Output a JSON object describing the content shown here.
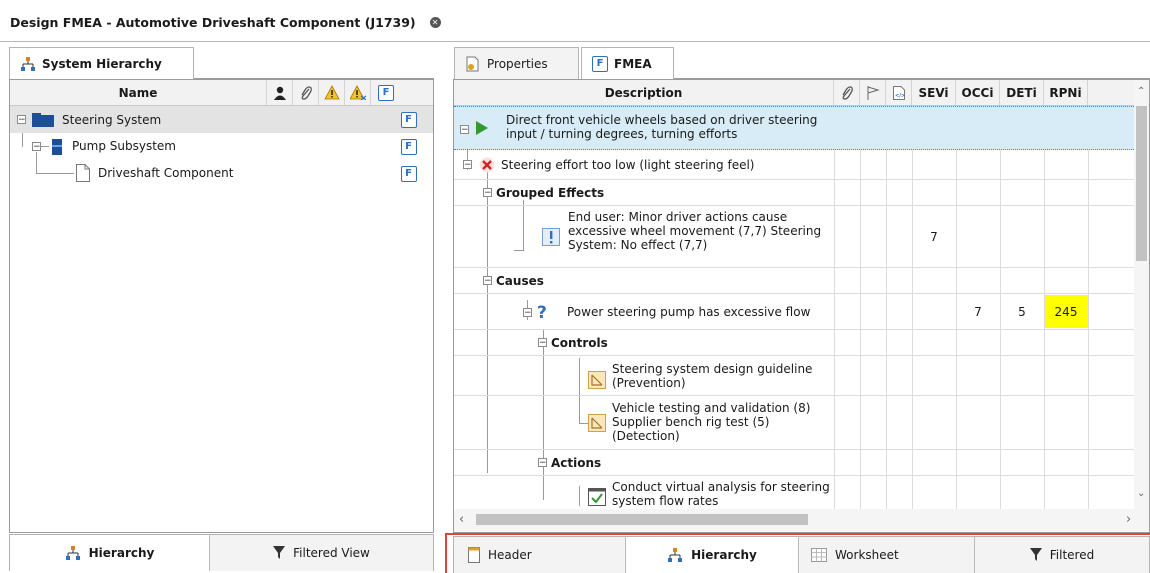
{
  "document_tab": {
    "title": "Design FMEA - Automotive Driveshaft Component (J1739)"
  },
  "left_panel": {
    "tab_label": "System Hierarchy",
    "columns": {
      "name": "Name"
    },
    "tree": [
      {
        "label": "Steering System",
        "expander": "−"
      },
      {
        "label": "Pump Subsystem",
        "expander": "−"
      },
      {
        "label": "Driveshaft Component"
      }
    ],
    "bottom_tabs": [
      {
        "label": "Hierarchy"
      },
      {
        "label": "Filtered View"
      }
    ]
  },
  "right_panel": {
    "tabs": [
      {
        "label": "Properties"
      },
      {
        "label": "FMEA"
      }
    ],
    "columns": {
      "description": "Description",
      "sev": "SEVi",
      "occ": "OCCi",
      "det": "DETi",
      "rpn": "RPNi"
    },
    "function_text": "Direct front vehicle wheels based on driver steering input / turning degrees, turning efforts",
    "failure_text": "Steering effort too low (light steering feel)",
    "grouped_effects_label": "Grouped Effects",
    "effect_text": "End user: Minor driver actions cause excessive wheel movement (7,7) Steering System: No effect (7,7)",
    "effect_sev": "7",
    "causes_label": "Causes",
    "cause_text": "Power steering pump has excessive flow",
    "cause_occ": "7",
    "cause_det": "5",
    "cause_rpn": "245",
    "controls_label": "Controls",
    "control_1": "Steering system design guideline (Prevention)",
    "control_2": "Vehicle testing and validation (8) Supplier bench rig test (5) (Detection)",
    "actions_label": "Actions",
    "action_1": "Conduct virtual analysis for steering system flow rates",
    "rpn_highlight_color": "#ffff00",
    "bottom_tabs": [
      {
        "label": "Header"
      },
      {
        "label": "Hierarchy"
      },
      {
        "label": "Worksheet"
      },
      {
        "label": "Filtered"
      }
    ],
    "highlight_border_color": "#e04040"
  }
}
